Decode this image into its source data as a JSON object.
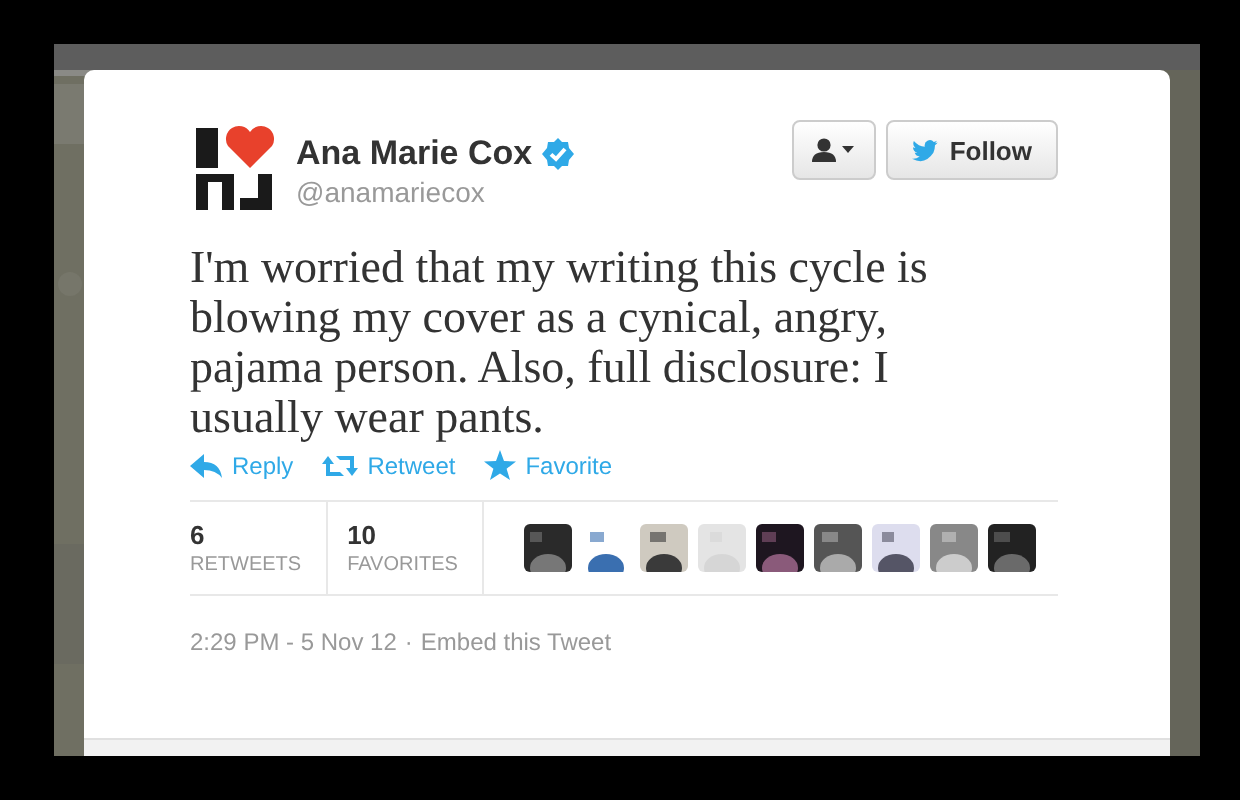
{
  "tweet": {
    "author": {
      "name": "Ana Marie Cox",
      "verified": true,
      "handle": "@anamariecox"
    },
    "buttons": [
      {
        "kind": "user-menu"
      },
      {
        "kind": "follow",
        "label": "Follow"
      }
    ],
    "text": "I'm worried that my writing this cycle is blowing my cover as a cynical, angry, pajama person. Also, full disclosure: I usually wear pants.",
    "actions": [
      {
        "kind": "reply",
        "label": "Reply"
      },
      {
        "kind": "retweet",
        "label": "Retweet"
      },
      {
        "kind": "favorite",
        "label": "Favorite"
      }
    ],
    "stats": [
      {
        "count": "6",
        "label": "RETWEETS"
      },
      {
        "count": "10",
        "label": "FAVORITES"
      }
    ],
    "timestamp": "2:29 PM - 5 Nov 12",
    "separator": "·",
    "embed_link": "Embed this Tweet"
  }
}
